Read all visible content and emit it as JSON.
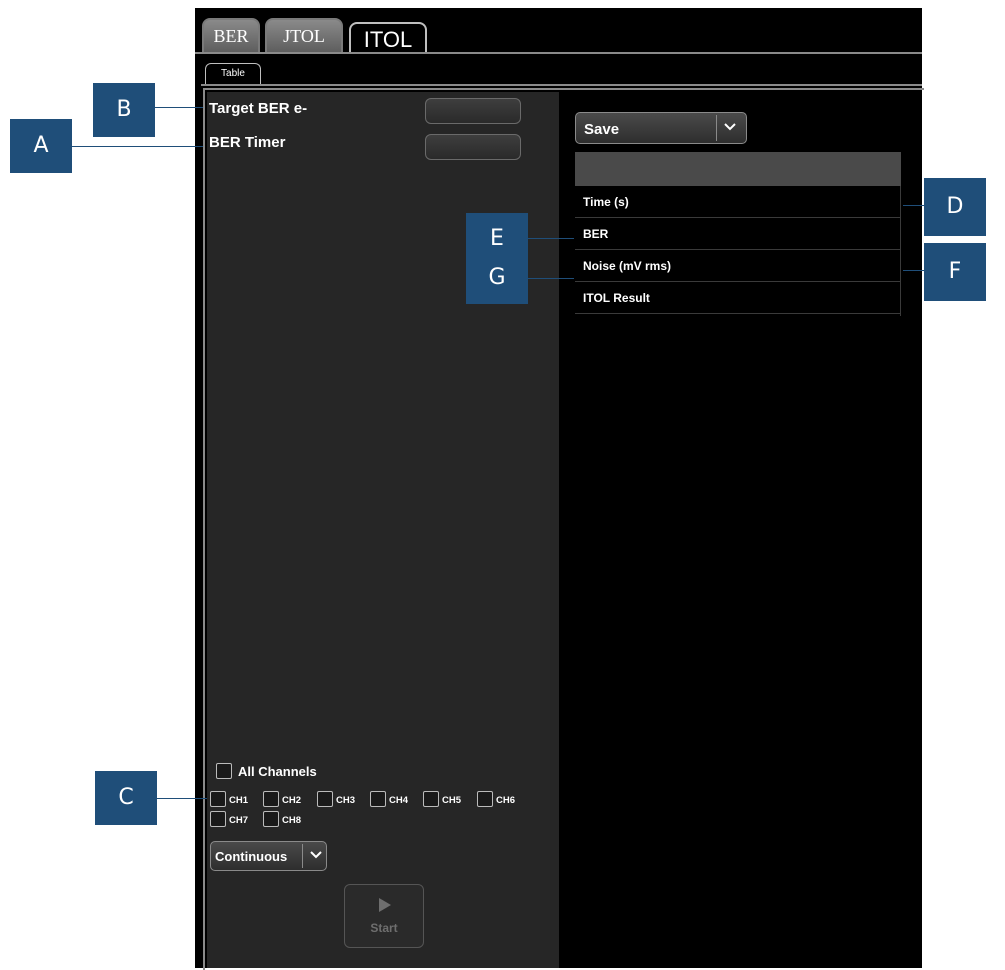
{
  "tabs": [
    {
      "label": "BER",
      "active": false
    },
    {
      "label": "JTOL",
      "active": false
    },
    {
      "label": "ITOL",
      "active": true
    }
  ],
  "subtab": {
    "label": "Table"
  },
  "settings": {
    "target_ber_label": "Target BER e-",
    "ber_timer_label": "BER Timer"
  },
  "channels": {
    "all_label": "All Channels",
    "items": [
      "CH1",
      "CH2",
      "CH3",
      "CH4",
      "CH5",
      "CH6",
      "CH7",
      "CH8"
    ]
  },
  "mode_dropdown": {
    "value": "Continuous"
  },
  "start_button": {
    "label": "Start"
  },
  "save_dropdown": {
    "value": "Save"
  },
  "results_table": {
    "rows": [
      "Time (s)",
      "BER",
      "Noise (mV rms)",
      "ITOL Result"
    ]
  },
  "callouts": [
    "A",
    "B",
    "C",
    "D",
    "E",
    "F",
    "G"
  ],
  "colors": {
    "callout": "#1f4e79",
    "panel": "#262626",
    "background": "#000000"
  }
}
